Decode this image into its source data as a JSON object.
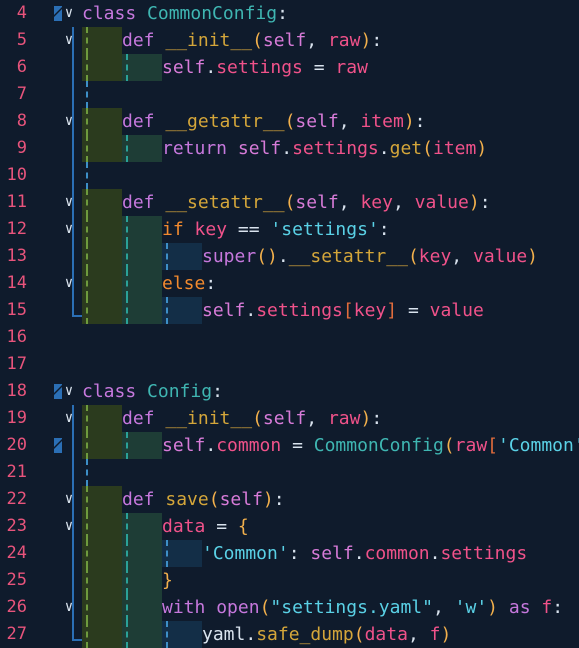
{
  "editor": {
    "lines": [
      {
        "n": "4",
        "tokens": [
          [
            "kw",
            "class"
          ],
          [
            "plain",
            " "
          ],
          [
            "cls",
            "CommonConfig"
          ],
          [
            "op",
            ":"
          ]
        ]
      },
      {
        "n": "5",
        "tokens": [
          [
            "kw",
            "def"
          ],
          [
            "plain",
            " "
          ],
          [
            "fn",
            "__init__"
          ],
          [
            "punc",
            "("
          ],
          [
            "self",
            "self"
          ],
          [
            "op",
            ", "
          ],
          [
            "param",
            "raw"
          ],
          [
            "punc",
            ")"
          ],
          [
            "op",
            ":"
          ]
        ]
      },
      {
        "n": "6",
        "tokens": [
          [
            "self",
            "self"
          ],
          [
            "op",
            "."
          ],
          [
            "attr",
            "settings"
          ],
          [
            "op",
            " = "
          ],
          [
            "param",
            "raw"
          ]
        ]
      },
      {
        "n": "7",
        "tokens": []
      },
      {
        "n": "8",
        "tokens": [
          [
            "kw",
            "def"
          ],
          [
            "plain",
            " "
          ],
          [
            "fn",
            "__getattr__"
          ],
          [
            "punc",
            "("
          ],
          [
            "self",
            "self"
          ],
          [
            "op",
            ", "
          ],
          [
            "param",
            "item"
          ],
          [
            "punc",
            ")"
          ],
          [
            "op",
            ":"
          ]
        ]
      },
      {
        "n": "9",
        "tokens": [
          [
            "kw",
            "return"
          ],
          [
            "plain",
            " "
          ],
          [
            "self",
            "self"
          ],
          [
            "op",
            "."
          ],
          [
            "attr",
            "settings"
          ],
          [
            "op",
            "."
          ],
          [
            "fn",
            "get"
          ],
          [
            "punc",
            "("
          ],
          [
            "param",
            "item"
          ],
          [
            "punc",
            ")"
          ]
        ]
      },
      {
        "n": "10",
        "tokens": []
      },
      {
        "n": "11",
        "tokens": [
          [
            "kw",
            "def"
          ],
          [
            "plain",
            " "
          ],
          [
            "fn",
            "__setattr__"
          ],
          [
            "punc",
            "("
          ],
          [
            "self",
            "self"
          ],
          [
            "op",
            ", "
          ],
          [
            "param",
            "key"
          ],
          [
            "op",
            ", "
          ],
          [
            "param",
            "value"
          ],
          [
            "punc",
            ")"
          ],
          [
            "op",
            ":"
          ]
        ]
      },
      {
        "n": "12",
        "tokens": [
          [
            "ctl",
            "if"
          ],
          [
            "plain",
            " "
          ],
          [
            "param",
            "key"
          ],
          [
            "op",
            " == "
          ],
          [
            "str",
            "'settings'"
          ],
          [
            "op",
            ":"
          ]
        ]
      },
      {
        "n": "13",
        "tokens": [
          [
            "builtin",
            "super"
          ],
          [
            "punc",
            "()"
          ],
          [
            "op",
            "."
          ],
          [
            "fn",
            "__setattr__"
          ],
          [
            "punc",
            "("
          ],
          [
            "param",
            "key"
          ],
          [
            "op",
            ", "
          ],
          [
            "param",
            "value"
          ],
          [
            "punc",
            ")"
          ]
        ]
      },
      {
        "n": "14",
        "tokens": [
          [
            "ctl",
            "else"
          ],
          [
            "op",
            ":"
          ]
        ]
      },
      {
        "n": "15",
        "tokens": [
          [
            "self",
            "self"
          ],
          [
            "op",
            "."
          ],
          [
            "attr",
            "settings"
          ],
          [
            "br",
            "["
          ],
          [
            "param",
            "key"
          ],
          [
            "br",
            "]"
          ],
          [
            "op",
            " = "
          ],
          [
            "param",
            "value"
          ]
        ]
      },
      {
        "n": "16",
        "tokens": []
      },
      {
        "n": "17",
        "tokens": []
      },
      {
        "n": "18",
        "tokens": [
          [
            "kw",
            "class"
          ],
          [
            "plain",
            " "
          ],
          [
            "cls",
            "Config"
          ],
          [
            "op",
            ":"
          ]
        ]
      },
      {
        "n": "19",
        "tokens": [
          [
            "kw",
            "def"
          ],
          [
            "plain",
            " "
          ],
          [
            "fn",
            "__init__"
          ],
          [
            "punc",
            "("
          ],
          [
            "self",
            "self"
          ],
          [
            "op",
            ", "
          ],
          [
            "param",
            "raw"
          ],
          [
            "punc",
            ")"
          ],
          [
            "op",
            ":"
          ]
        ]
      },
      {
        "n": "20",
        "tokens": [
          [
            "self",
            "self"
          ],
          [
            "op",
            "."
          ],
          [
            "attr",
            "common"
          ],
          [
            "op",
            " = "
          ],
          [
            "cls",
            "CommonConfig"
          ],
          [
            "punc",
            "("
          ],
          [
            "param",
            "raw"
          ],
          [
            "br",
            "["
          ],
          [
            "str",
            "'Common'"
          ],
          [
            "br",
            "]"
          ],
          [
            "punc",
            ")"
          ]
        ]
      },
      {
        "n": "21",
        "tokens": []
      },
      {
        "n": "22",
        "tokens": [
          [
            "kw",
            "def"
          ],
          [
            "plain",
            " "
          ],
          [
            "fn",
            "save"
          ],
          [
            "punc",
            "("
          ],
          [
            "self",
            "self"
          ],
          [
            "punc",
            ")"
          ],
          [
            "op",
            ":"
          ]
        ]
      },
      {
        "n": "23",
        "tokens": [
          [
            "param",
            "data"
          ],
          [
            "op",
            " = "
          ],
          [
            "punc",
            "{"
          ]
        ]
      },
      {
        "n": "24",
        "tokens": [
          [
            "str",
            "'Common'"
          ],
          [
            "op",
            ": "
          ],
          [
            "self",
            "self"
          ],
          [
            "op",
            "."
          ],
          [
            "attr",
            "common"
          ],
          [
            "op",
            "."
          ],
          [
            "attr",
            "settings"
          ]
        ]
      },
      {
        "n": "25",
        "tokens": [
          [
            "punc",
            "}"
          ]
        ]
      },
      {
        "n": "26",
        "tokens": [
          [
            "kw",
            "with"
          ],
          [
            "plain",
            " "
          ],
          [
            "builtin",
            "open"
          ],
          [
            "punc",
            "("
          ],
          [
            "str",
            "\"settings.yaml\""
          ],
          [
            "op",
            ", "
          ],
          [
            "str",
            "'w'"
          ],
          [
            "punc",
            ")"
          ],
          [
            "plain",
            " "
          ],
          [
            "kw",
            "as"
          ],
          [
            "plain",
            " "
          ],
          [
            "param",
            "f"
          ],
          [
            "op",
            ":"
          ]
        ]
      },
      {
        "n": "27",
        "tokens": [
          [
            "plain",
            "yaml"
          ],
          [
            "op",
            "."
          ],
          [
            "fn",
            "safe_dump"
          ],
          [
            "punc",
            "("
          ],
          [
            "param",
            "data"
          ],
          [
            "op",
            ", "
          ],
          [
            "param",
            "f"
          ],
          [
            "punc",
            ")"
          ]
        ]
      }
    ]
  },
  "colors": {
    "background": "#0f1b2c",
    "line_number": "#e8547c",
    "keyword": "#c678dd",
    "class_name": "#3fb6b2",
    "function": "#d4a63a",
    "string": "#5ad1e6",
    "self": "#d77bd8",
    "param": "#f0528a"
  }
}
